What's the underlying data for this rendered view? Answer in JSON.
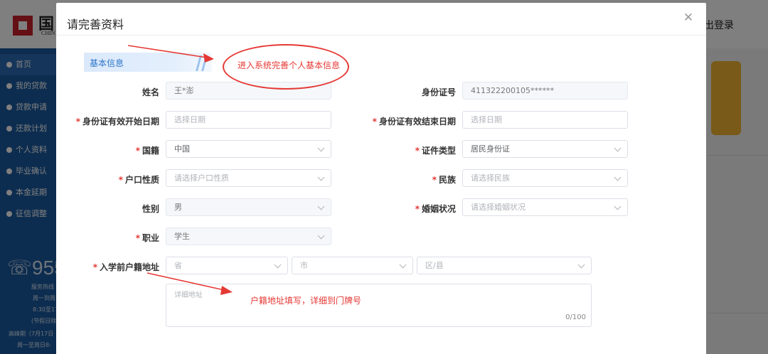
{
  "background": {
    "logo_text": "国",
    "logo_sub": "CHIN",
    "logout": "出登录",
    "nav": [
      "首页",
      "我的贷款",
      "贷款申请",
      "还款计划",
      "个人资料",
      "毕业确认",
      "本金延期",
      "征信调整"
    ],
    "hotline": "955",
    "hotline_lines": [
      "服务热线",
      "周一到周",
      "8:30至17",
      "(节假日除",
      "高峰期（7月17日",
      "周一至周日8:"
    ]
  },
  "modal": {
    "title": "请完善资料",
    "close_icon": "close-icon",
    "section_label": "基本信息",
    "fields": {
      "name": {
        "label": "姓名",
        "value": "王*澎"
      },
      "id_number": {
        "label": "身份证号",
        "value": "411322200105******"
      },
      "id_start": {
        "label": "身份证有效开始日期",
        "placeholder": "选择日期"
      },
      "id_end": {
        "label": "身份证有效结束日期",
        "placeholder": "选择日期"
      },
      "nationality": {
        "label": "国籍",
        "value": "中国"
      },
      "cert_type": {
        "label": "证件类型",
        "value": "居民身份证"
      },
      "hukou_type": {
        "label": "户口性质",
        "placeholder": "请选择户口性质"
      },
      "ethnicity": {
        "label": "民族",
        "placeholder": "请选择民族"
      },
      "gender": {
        "label": "性别",
        "value": "男"
      },
      "marital": {
        "label": "婚姻状况",
        "placeholder": "请选择婚姻状况"
      },
      "occupation": {
        "label": "职业",
        "value": "学生"
      },
      "address": {
        "label": "入学前户籍地址",
        "province_placeholder": "省",
        "city_placeholder": "市",
        "district_placeholder": "区/县",
        "detail_placeholder": "详细地址",
        "counter": "0/100"
      }
    },
    "required_mark": "*"
  },
  "annotations": {
    "basic_info": "进入系统完善个人基本信息",
    "address": "户籍地址填写，详细到门牌号"
  },
  "colors": {
    "accent": "#2d75c8",
    "annotation": "#e53935",
    "sidebar": "#1a5aa0"
  }
}
